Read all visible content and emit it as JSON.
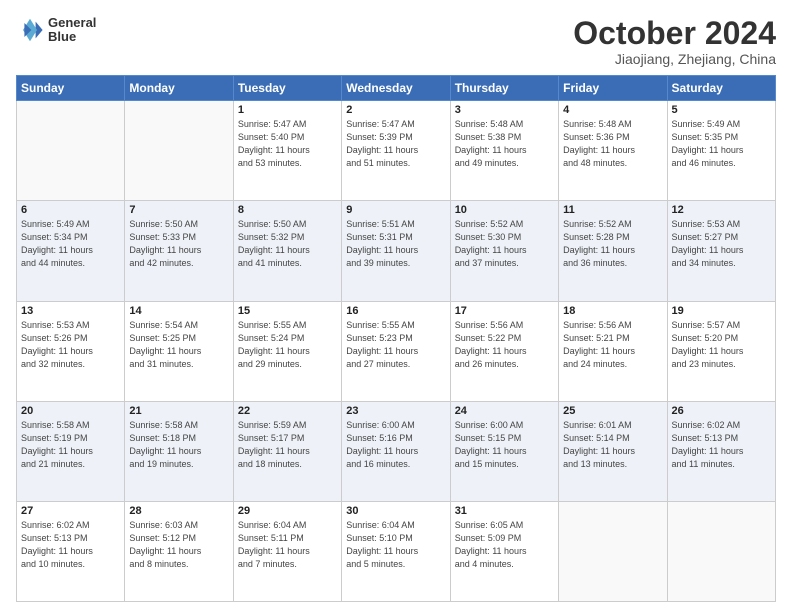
{
  "header": {
    "logo_line1": "General",
    "logo_line2": "Blue",
    "month": "October 2024",
    "location": "Jiaojiang, Zhejiang, China"
  },
  "weekdays": [
    "Sunday",
    "Monday",
    "Tuesday",
    "Wednesday",
    "Thursday",
    "Friday",
    "Saturday"
  ],
  "weeks": [
    [
      {
        "day": "",
        "info": ""
      },
      {
        "day": "",
        "info": ""
      },
      {
        "day": "1",
        "info": "Sunrise: 5:47 AM\nSunset: 5:40 PM\nDaylight: 11 hours\nand 53 minutes."
      },
      {
        "day": "2",
        "info": "Sunrise: 5:47 AM\nSunset: 5:39 PM\nDaylight: 11 hours\nand 51 minutes."
      },
      {
        "day": "3",
        "info": "Sunrise: 5:48 AM\nSunset: 5:38 PM\nDaylight: 11 hours\nand 49 minutes."
      },
      {
        "day": "4",
        "info": "Sunrise: 5:48 AM\nSunset: 5:36 PM\nDaylight: 11 hours\nand 48 minutes."
      },
      {
        "day": "5",
        "info": "Sunrise: 5:49 AM\nSunset: 5:35 PM\nDaylight: 11 hours\nand 46 minutes."
      }
    ],
    [
      {
        "day": "6",
        "info": "Sunrise: 5:49 AM\nSunset: 5:34 PM\nDaylight: 11 hours\nand 44 minutes."
      },
      {
        "day": "7",
        "info": "Sunrise: 5:50 AM\nSunset: 5:33 PM\nDaylight: 11 hours\nand 42 minutes."
      },
      {
        "day": "8",
        "info": "Sunrise: 5:50 AM\nSunset: 5:32 PM\nDaylight: 11 hours\nand 41 minutes."
      },
      {
        "day": "9",
        "info": "Sunrise: 5:51 AM\nSunset: 5:31 PM\nDaylight: 11 hours\nand 39 minutes."
      },
      {
        "day": "10",
        "info": "Sunrise: 5:52 AM\nSunset: 5:30 PM\nDaylight: 11 hours\nand 37 minutes."
      },
      {
        "day": "11",
        "info": "Sunrise: 5:52 AM\nSunset: 5:28 PM\nDaylight: 11 hours\nand 36 minutes."
      },
      {
        "day": "12",
        "info": "Sunrise: 5:53 AM\nSunset: 5:27 PM\nDaylight: 11 hours\nand 34 minutes."
      }
    ],
    [
      {
        "day": "13",
        "info": "Sunrise: 5:53 AM\nSunset: 5:26 PM\nDaylight: 11 hours\nand 32 minutes."
      },
      {
        "day": "14",
        "info": "Sunrise: 5:54 AM\nSunset: 5:25 PM\nDaylight: 11 hours\nand 31 minutes."
      },
      {
        "day": "15",
        "info": "Sunrise: 5:55 AM\nSunset: 5:24 PM\nDaylight: 11 hours\nand 29 minutes."
      },
      {
        "day": "16",
        "info": "Sunrise: 5:55 AM\nSunset: 5:23 PM\nDaylight: 11 hours\nand 27 minutes."
      },
      {
        "day": "17",
        "info": "Sunrise: 5:56 AM\nSunset: 5:22 PM\nDaylight: 11 hours\nand 26 minutes."
      },
      {
        "day": "18",
        "info": "Sunrise: 5:56 AM\nSunset: 5:21 PM\nDaylight: 11 hours\nand 24 minutes."
      },
      {
        "day": "19",
        "info": "Sunrise: 5:57 AM\nSunset: 5:20 PM\nDaylight: 11 hours\nand 23 minutes."
      }
    ],
    [
      {
        "day": "20",
        "info": "Sunrise: 5:58 AM\nSunset: 5:19 PM\nDaylight: 11 hours\nand 21 minutes."
      },
      {
        "day": "21",
        "info": "Sunrise: 5:58 AM\nSunset: 5:18 PM\nDaylight: 11 hours\nand 19 minutes."
      },
      {
        "day": "22",
        "info": "Sunrise: 5:59 AM\nSunset: 5:17 PM\nDaylight: 11 hours\nand 18 minutes."
      },
      {
        "day": "23",
        "info": "Sunrise: 6:00 AM\nSunset: 5:16 PM\nDaylight: 11 hours\nand 16 minutes."
      },
      {
        "day": "24",
        "info": "Sunrise: 6:00 AM\nSunset: 5:15 PM\nDaylight: 11 hours\nand 15 minutes."
      },
      {
        "day": "25",
        "info": "Sunrise: 6:01 AM\nSunset: 5:14 PM\nDaylight: 11 hours\nand 13 minutes."
      },
      {
        "day": "26",
        "info": "Sunrise: 6:02 AM\nSunset: 5:13 PM\nDaylight: 11 hours\nand 11 minutes."
      }
    ],
    [
      {
        "day": "27",
        "info": "Sunrise: 6:02 AM\nSunset: 5:13 PM\nDaylight: 11 hours\nand 10 minutes."
      },
      {
        "day": "28",
        "info": "Sunrise: 6:03 AM\nSunset: 5:12 PM\nDaylight: 11 hours\nand 8 minutes."
      },
      {
        "day": "29",
        "info": "Sunrise: 6:04 AM\nSunset: 5:11 PM\nDaylight: 11 hours\nand 7 minutes."
      },
      {
        "day": "30",
        "info": "Sunrise: 6:04 AM\nSunset: 5:10 PM\nDaylight: 11 hours\nand 5 minutes."
      },
      {
        "day": "31",
        "info": "Sunrise: 6:05 AM\nSunset: 5:09 PM\nDaylight: 11 hours\nand 4 minutes."
      },
      {
        "day": "",
        "info": ""
      },
      {
        "day": "",
        "info": ""
      }
    ]
  ]
}
